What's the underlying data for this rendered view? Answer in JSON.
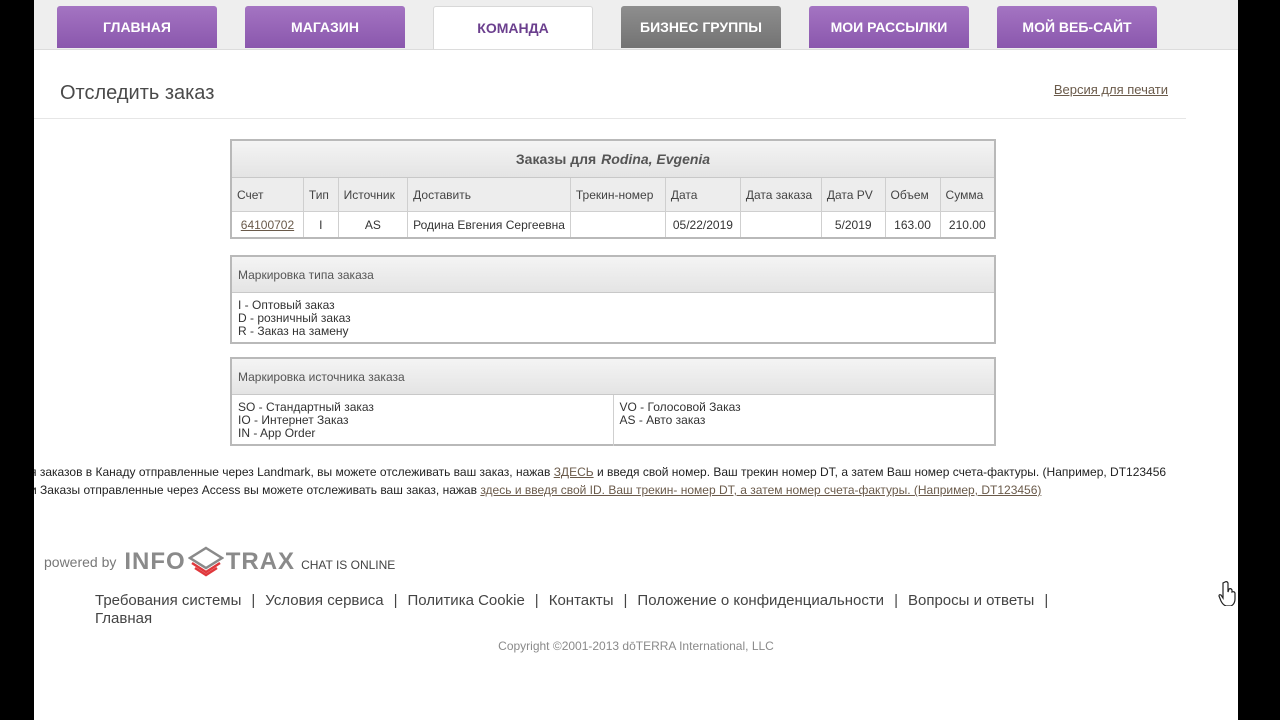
{
  "nav": {
    "tabs": [
      {
        "label": "ГЛАВНАЯ",
        "state": "purple"
      },
      {
        "label": "МАГАЗИН",
        "state": "purple"
      },
      {
        "label": "КОМАНДА",
        "state": "active"
      },
      {
        "label": "БИЗНЕС ГРУППЫ",
        "state": "gray"
      },
      {
        "label": "МОИ РАССЫЛКИ",
        "state": "purple"
      },
      {
        "label": "МОЙ ВЕБ-САЙТ",
        "state": "purple"
      }
    ]
  },
  "header": {
    "title": "Отследить заказ",
    "print_link": "Версия для печати"
  },
  "orders": {
    "caption_prefix": "Заказы для",
    "caption_name": "Rodina, Evgenia",
    "columns": [
      "Счет",
      "Тип",
      "Источник",
      "Доставить",
      "Трекин-номер",
      "Дата",
      "Дата заказа",
      "Дата PV",
      "Объем",
      "Сумма"
    ],
    "rows": [
      {
        "invoice": "64100702",
        "type": "I",
        "source": "AS",
        "ship_to": "Родина Евгения Сергеевна",
        "tracking": "",
        "date": "05/22/2019",
        "order_date": "",
        "pv_date": "5/2019",
        "volume": "163.00",
        "total": "210.00"
      }
    ]
  },
  "order_type_legend": {
    "title": "Маркировка типа заказа",
    "items": [
      "I - Оптовый заказ",
      "D - розничный заказ",
      "R - Заказ на замену"
    ]
  },
  "order_source_legend": {
    "title": "Маркировка источника заказа",
    "left_items": [
      "SO - Стандартный заказ",
      "IO - Интернет Заказ",
      "IN - App Order"
    ],
    "right_items": [
      "VO - Голосовой Заказ",
      "AS - Авто заказ"
    ]
  },
  "notes": {
    "line1_text": "я заказов в Канаду отправленные через Landmark, вы можете отслеживать ваш заказ, нажав",
    "line1_link": "ЗДЕСЬ",
    "line1_rest": "и введя свой номер. Ваш трекин номер DT, а затем Ваш номер счета-фактуры. (Например, DT123456",
    "line2_text": "и Заказы отправленные через Access вы можете отслеживать ваш заказ, нажав",
    "line2_link": "здесь и введя свой ID. Ваш трекин- номер DT, а затем номер счета-фактуры. (Например, DT123456)"
  },
  "footer": {
    "powered_by": "powered by",
    "brand_left": "INFO",
    "brand_right": "TRAX",
    "chat_status": "CHAT IS ONLINE",
    "links": [
      "Требования системы",
      "Условия сервиса",
      "Политика Cookie",
      "Контакты",
      "Положение о конфиденциальности",
      "Вопросы и ответы",
      "Главная"
    ],
    "copyright": "Copyright ©2001-2013 dōTERRA International, LLC"
  },
  "colors": {
    "tab_purple": "#9a66bd",
    "tab_gray": "#808080",
    "active_tab_text": "#6b3f8e"
  }
}
